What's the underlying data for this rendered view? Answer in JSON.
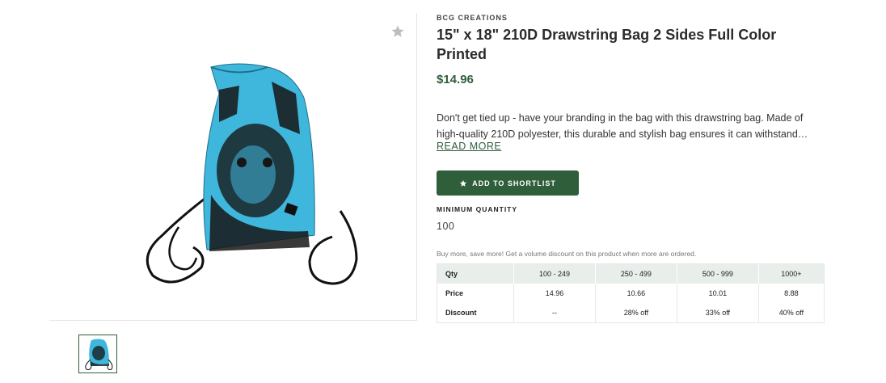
{
  "product": {
    "brand": "BCG CREATIONS",
    "title": "15\" x 18\" 210D Drawstring Bag 2 Sides Full Color Printed",
    "price": "$14.96",
    "description": "Don't get tied up - have your branding in the bag with this drawstring bag. Made of high-quality 210D polyester, this durable and stylish bag ensures it can withstand…",
    "read_more": "READ MORE"
  },
  "actions": {
    "shortlist_label": "ADD TO SHORTLIST",
    "shortlist_icon": "star-icon",
    "favorite_icon": "star-icon"
  },
  "min_quantity": {
    "label": "MINIMUM QUANTITY",
    "value": "100"
  },
  "volume": {
    "note": "Buy more, save more! Get a volume discount on this product when more are ordered.",
    "table": {
      "row_labels": [
        "Qty",
        "Price",
        "Discount"
      ],
      "columns": [
        {
          "qty": "100 - 249",
          "price": "14.96",
          "discount": "--"
        },
        {
          "qty": "250 - 499",
          "price": "10.66",
          "discount": "28% off"
        },
        {
          "qty": "500 - 999",
          "price": "10.01",
          "discount": "33% off"
        },
        {
          "qty": "1000+",
          "price": "8.88",
          "discount": "40% off"
        }
      ]
    }
  },
  "colors": {
    "accent": "#2f5e3a",
    "bag_blue": "#3fb7dc",
    "table_header": "#e8eeea"
  }
}
